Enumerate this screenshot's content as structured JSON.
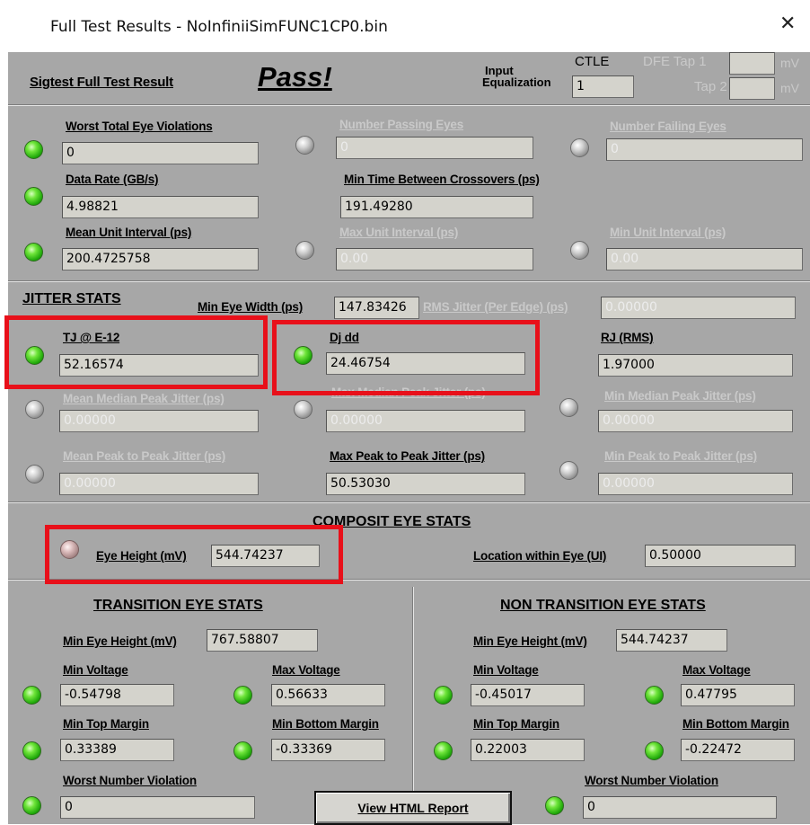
{
  "window": {
    "title": "Full Test Results - NoInfiniiSimFUNC1CP0.bin",
    "close_glyph": "✕"
  },
  "summary": {
    "label": "Sigtest Full Test Result",
    "result": "Pass!",
    "input_eq_label_1": "Input",
    "input_eq_label_2": "Equalization",
    "ctle_label": "CTLE",
    "ctle_value": "1",
    "dfe_tap1_label": "DFE Tap 1",
    "dfe_tap2_label": "Tap 2",
    "dfe_tap1_value": "",
    "dfe_tap2_value": "",
    "unit_mv_1": "mV",
    "unit_mv_2": "mV"
  },
  "eyes": {
    "worst_total_label": "Worst Total Eye Violations",
    "worst_total_value": "0",
    "passing_label": "Number Passing Eyes",
    "passing_value": "0",
    "failing_label": "Number Failing Eyes",
    "failing_value": "0",
    "data_rate_label": "Data Rate (GB/s)",
    "data_rate_value": "4.98821",
    "min_time_label": "Min Time Between Crossovers (ps)",
    "min_time_value": "191.49280",
    "mean_ui_label": "Mean Unit Interval (ps)",
    "mean_ui_value": "200.4725758",
    "max_ui_label": "Max Unit Interval (ps)",
    "max_ui_value": "0.00",
    "min_ui_label": "Min Unit Interval (ps)",
    "min_ui_value": "0.00"
  },
  "jitter": {
    "header": "JITTER STATS",
    "min_eye_width_label": "Min Eye Width (ps)",
    "min_eye_width_value": "147.83426",
    "rms_label": "RMS Jitter (Per Edge) (ps)",
    "rms_value": "0.00000",
    "tj_label": "TJ @ E-12",
    "tj_value": "52.16574",
    "dj_label": "Dj dd",
    "dj_value": "24.46754",
    "rj_label": "RJ (RMS)",
    "rj_value": "1.97000",
    "mean_median_label": "Mean Median Peak Jitter (ps)",
    "mean_median_value": "0.00000",
    "max_median_label": "Max Median Peak Jitter (ps)",
    "max_median_value": "0.00000",
    "min_median_label": "Min Median Peak Jitter (ps)",
    "min_median_value": "0.00000",
    "mean_p2p_label": "Mean Peak to Peak Jitter (ps)",
    "mean_p2p_value": "0.00000",
    "max_p2p_label": "Max Peak to Peak Jitter (ps)",
    "max_p2p_value": "50.53030",
    "min_p2p_label": "Min Peak to Peak Jitter (ps)",
    "min_p2p_value": "0.00000"
  },
  "composite": {
    "header": "COMPOSIT EYE STATS",
    "eye_height_label": "Eye Height (mV)",
    "eye_height_value": "544.74237",
    "location_label": "Location within Eye (UI)",
    "location_value": "0.50000"
  },
  "transition": {
    "header": "TRANSITION EYE STATS",
    "min_eye_height_label": "Min Eye Height (mV)",
    "min_eye_height_value": "767.58807",
    "min_voltage_label": "Min Voltage",
    "min_voltage_value": "-0.54798",
    "max_voltage_label": "Max Voltage",
    "max_voltage_value": "0.56633",
    "min_top_label": "Min Top Margin",
    "min_top_value": "0.33389",
    "min_bottom_label": "Min Bottom Margin",
    "min_bottom_value": "-0.33369",
    "worst_label": "Worst Number Violation",
    "worst_value": "0"
  },
  "non_transition": {
    "header": "NON TRANSITION EYE STATS",
    "min_eye_height_label": "Min Eye Height (mV)",
    "min_eye_height_value": "544.74237",
    "min_voltage_label": "Min Voltage",
    "min_voltage_value": "-0.45017",
    "max_voltage_label": "Max Voltage",
    "max_voltage_value": "0.47795",
    "min_top_label": "Min Top Margin",
    "min_top_value": "0.22003",
    "min_bottom_label": "Min Bottom Margin",
    "min_bottom_value": "-0.22472",
    "worst_label": "Worst Number Violation",
    "worst_value": "0"
  },
  "report_button": "View HTML Report",
  "colors": {
    "panel": "#a7a7a7",
    "highlight": "#e8101a",
    "led_green": "#1fa80a"
  }
}
